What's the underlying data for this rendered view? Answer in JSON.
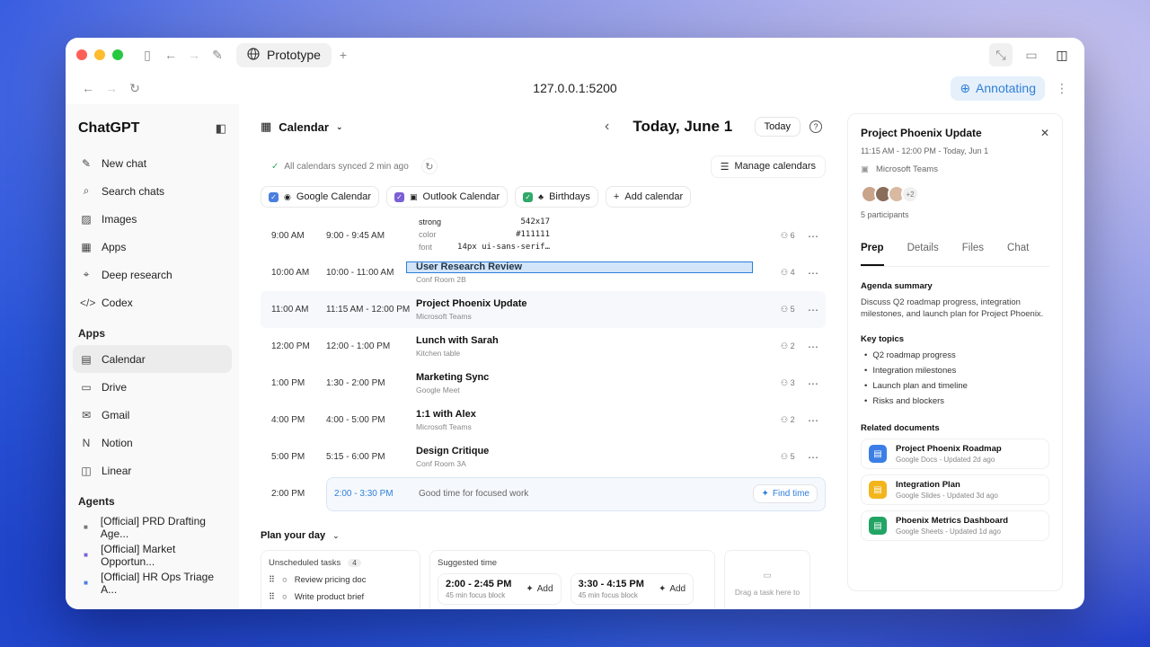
{
  "browser": {
    "tab_title": "Prototype",
    "url": "127.0.0.1:5200",
    "annotating_label": "Annotating"
  },
  "sidebar": {
    "logo": "ChatGPT",
    "nav": [
      {
        "label": "New chat",
        "icon": "edit-icon"
      },
      {
        "label": "Search chats",
        "icon": "search-icon"
      },
      {
        "label": "Images",
        "icon": "image-icon"
      },
      {
        "label": "Apps",
        "icon": "grid-icon"
      },
      {
        "label": "Deep research",
        "icon": "telescope-icon"
      },
      {
        "label": "Codex",
        "icon": "code-icon"
      }
    ],
    "apps_heading": "Apps",
    "apps": [
      {
        "label": "Calendar",
        "icon": "calendar-icon"
      },
      {
        "label": "Drive",
        "icon": "drive-icon"
      },
      {
        "label": "Gmail",
        "icon": "mail-icon"
      },
      {
        "label": "Notion",
        "icon": "notion-icon"
      },
      {
        "label": "Linear",
        "icon": "linear-icon"
      }
    ],
    "agents_heading": "Agents",
    "agents": [
      {
        "label": "[Official] PRD Drafting Age..."
      },
      {
        "label": "[Official] Market Opportun..."
      },
      {
        "label": "[Official] HR Ops Triage A..."
      }
    ]
  },
  "calendar": {
    "title": "Calendar",
    "date_title": "Today, June 1",
    "today_label": "Today",
    "sync_text": "All calendars synced 2 min ago",
    "manage_label": "Manage calendars",
    "chips": [
      {
        "label": "Google Calendar",
        "color": "#4a7fe0"
      },
      {
        "label": "Outlook Calendar",
        "color": "#7b5fd6"
      },
      {
        "label": "Birthdays",
        "color": "#2fa86a"
      }
    ],
    "add_calendar_label": "Add calendar",
    "events": [
      {
        "hour": "9:00 AM",
        "range": "9:00 - 9:45 AM",
        "name": "",
        "loc": "",
        "ppl": "6"
      },
      {
        "hour": "10:00 AM",
        "range": "10:00 - 11:00 AM",
        "name": "User Research Review",
        "loc": "Conf Room 2B",
        "ppl": "4"
      },
      {
        "hour": "11:00 AM",
        "range": "11:15 AM - 12:00 PM",
        "name": "Project Phoenix Update",
        "loc": "Microsoft Teams",
        "ppl": "5"
      },
      {
        "hour": "12:00 PM",
        "range": "12:00 - 1:00 PM",
        "name": "Lunch with Sarah",
        "loc": "Kitchen table",
        "ppl": "2"
      },
      {
        "hour": "1:00 PM",
        "range": "1:30 - 2:00 PM",
        "name": "Marketing Sync",
        "loc": "Google Meet",
        "ppl": "3"
      },
      {
        "hour": "4:00 PM",
        "range": "4:00 - 5:00 PM",
        "name": "1:1 with Alex",
        "loc": "Microsoft Teams",
        "ppl": "2"
      },
      {
        "hour": "5:00 PM",
        "range": "5:15 - 6:00 PM",
        "name": "Design Critique",
        "loc": "Conf Room 3A",
        "ppl": "5"
      }
    ],
    "focus": {
      "hour": "2:00 PM",
      "range": "2:00 - 3:30 PM",
      "text": "Good time for focused work",
      "button": "Find time"
    },
    "tooltip": {
      "tag": "strong",
      "size": "542x17",
      "color_key": "color",
      "color_val": "#111111",
      "font_key": "font",
      "font_val": "14px ui-sans-serif…"
    },
    "plan": {
      "heading": "Plan your day",
      "unscheduled_label": "Unscheduled tasks",
      "unscheduled_count": "4",
      "tasks": [
        "Review pricing doc",
        "Write product brief"
      ],
      "suggested_label": "Suggested time",
      "slots": [
        {
          "time": "2:00 - 2:45 PM",
          "sub": "45 min focus block",
          "add": "Add"
        },
        {
          "time": "3:30 - 4:15 PM",
          "sub": "45 min focus block",
          "add": "Add"
        }
      ],
      "drop_text": "Drag a task here to"
    }
  },
  "detail": {
    "title": "Project Phoenix Update",
    "time": "11:15 AM - 12:00 PM - Today, Jun 1",
    "app": "Microsoft Teams",
    "extra": "+2",
    "participants": "5 participants",
    "tabs": [
      "Prep",
      "Details",
      "Files",
      "Chat"
    ],
    "agenda_h": "Agenda summary",
    "agenda_p": "Discuss Q2 roadmap progress, integration milestones, and launch plan for Project Phoenix.",
    "topics_h": "Key topics",
    "topics": [
      "Q2 roadmap progress",
      "Integration milestones",
      "Launch plan and timeline",
      "Risks and blockers"
    ],
    "docs_h": "Related documents",
    "docs": [
      {
        "title": "Project Phoenix Roadmap",
        "sub": "Google Docs - Updated 2d ago",
        "color": "#3b7ee6"
      },
      {
        "title": "Integration Plan",
        "sub": "Google Slides - Updated 3d ago",
        "color": "#f2b51b"
      },
      {
        "title": "Phoenix Metrics Dashboard",
        "sub": "Google Sheets - Updated 1d ago",
        "color": "#21a464"
      }
    ]
  }
}
